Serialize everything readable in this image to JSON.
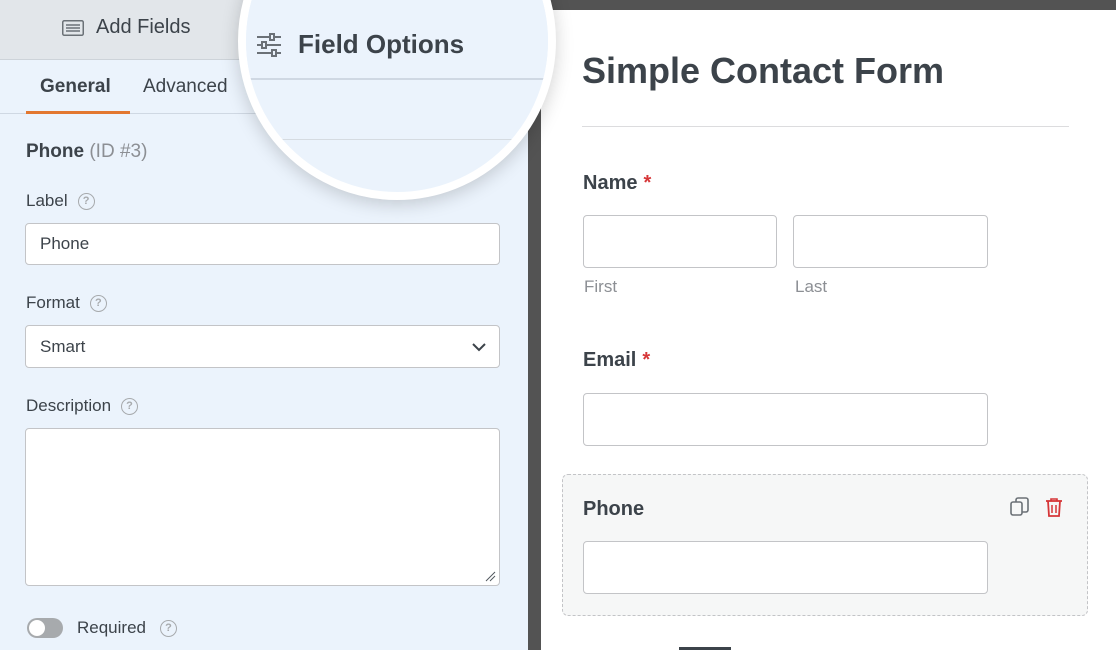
{
  "sidebar": {
    "add_fields_tab": "Add Fields",
    "field_options_tab": "Field Options",
    "subtabs": {
      "general": "General",
      "advanced": "Advanced"
    },
    "field": {
      "name": "Phone",
      "id": "(ID #3)"
    },
    "label_label": "Label",
    "label_value": "Phone",
    "format_label": "Format",
    "format_value": "Smart",
    "description_label": "Description",
    "description_value": "",
    "required_label": "Required",
    "required_on": false,
    "help_glyph": "?"
  },
  "preview": {
    "title": "Simple Contact Form",
    "required_marker": "*",
    "name": {
      "label": "Name",
      "first": "First",
      "last": "Last"
    },
    "email": {
      "label": "Email"
    },
    "phone": {
      "label": "Phone"
    }
  },
  "colors": {
    "accent": "#e27730",
    "required": "#d63638",
    "delete_icon": "#d63638",
    "sidebar_bg": "#ebf3fc"
  },
  "icons": [
    "list-icon",
    "sliders-icon",
    "help-icon",
    "chevron-down-icon",
    "duplicate-icon",
    "trash-icon",
    "resize-grip-icon"
  ]
}
